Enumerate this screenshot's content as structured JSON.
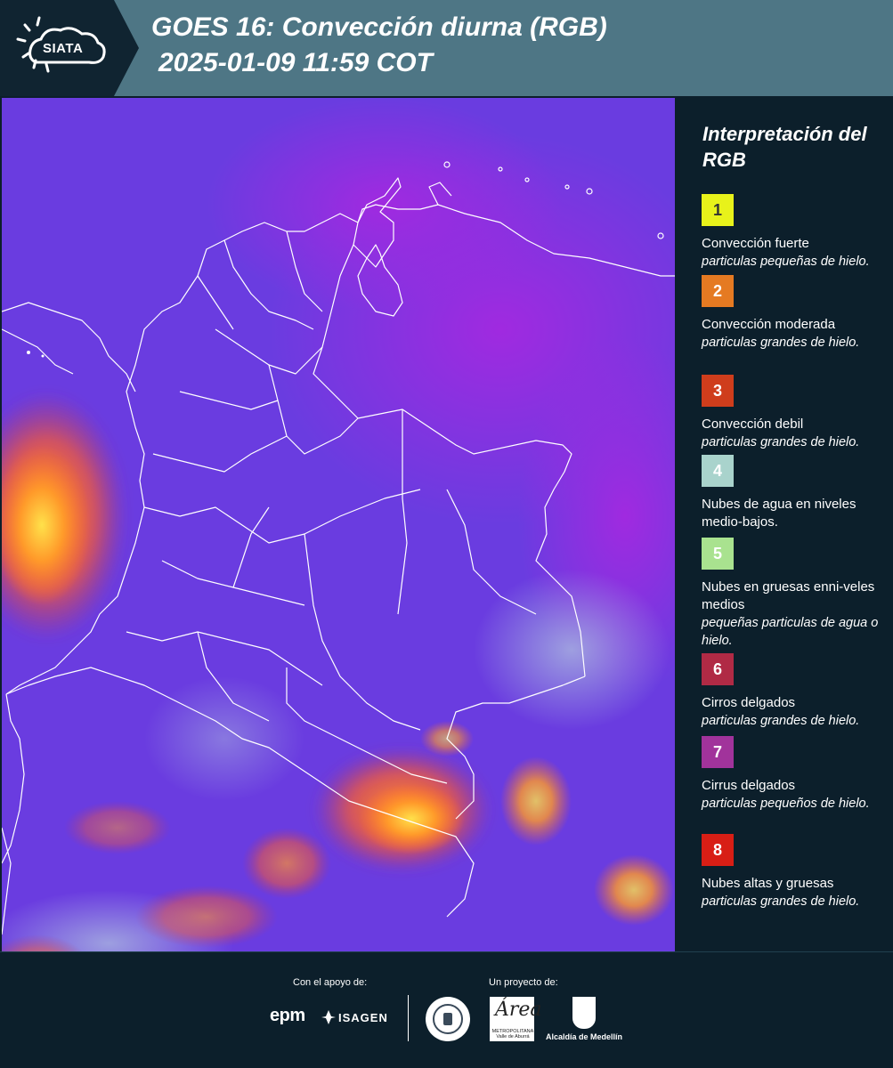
{
  "header": {
    "brand": "SIATA",
    "title_line1": "GOES 16: Convección diurna (RGB)",
    "title_line2": "2025-01-09 11:59 COT",
    "band_color": "#4e7685",
    "logo_bg": "#102431"
  },
  "map": {
    "base_color": "#6a3ce0",
    "accent_colors": [
      "#8a2be2",
      "#ff9a2a",
      "#ffd030",
      "#9fb8d8"
    ],
    "boundary_color": "#ffffff"
  },
  "legend": {
    "title": "Interpretación del RGB",
    "items": [
      {
        "num": "1",
        "color": "#e8f21a",
        "text_color": "#333333",
        "label": "Convección fuerte",
        "sub": "particulas pequeñas de hielo."
      },
      {
        "num": "2",
        "color": "#e57a22",
        "text_color": "#ffffff",
        "label": "Convección moderada",
        "sub": "particulas grandes de hielo."
      },
      {
        "num": "3",
        "color": "#cf3d1c",
        "text_color": "#ffffff",
        "label": "Convección debil",
        "sub": "particulas grandes de hielo."
      },
      {
        "num": "4",
        "color": "#a9d3cc",
        "text_color": "#ffffff",
        "label": "Nubes de agua en niveles medio-bajos.",
        "sub": ""
      },
      {
        "num": "5",
        "color": "#a9e28f",
        "text_color": "#ffffff",
        "label": "Nubes en gruesas enni-veles medios",
        "sub": "pequeñas particulas de agua o hielo."
      },
      {
        "num": "6",
        "color": "#b02a45",
        "text_color": "#ffffff",
        "label": "Cirros delgados",
        "sub": "particulas grandes de hielo."
      },
      {
        "num": "7",
        "color": "#a1339b",
        "text_color": "#ffffff",
        "label": "Cirrus delgados",
        "sub": "particulas pequeños de hielo."
      },
      {
        "num": "8",
        "color": "#d81e15",
        "text_color": "#ffffff",
        "label": "Nubes altas y gruesas",
        "sub": "particulas grandes de hielo."
      }
    ]
  },
  "footer": {
    "support_label": "Con el apoyo de:",
    "project_label": "Un proyecto de:",
    "epm": "epm",
    "isagen": "ISAGEN",
    "area_mark": "Área",
    "area_sub": "METROPOLITANA Valle de Aburrá",
    "alcaldia": "Alcaldía de Medellín"
  }
}
